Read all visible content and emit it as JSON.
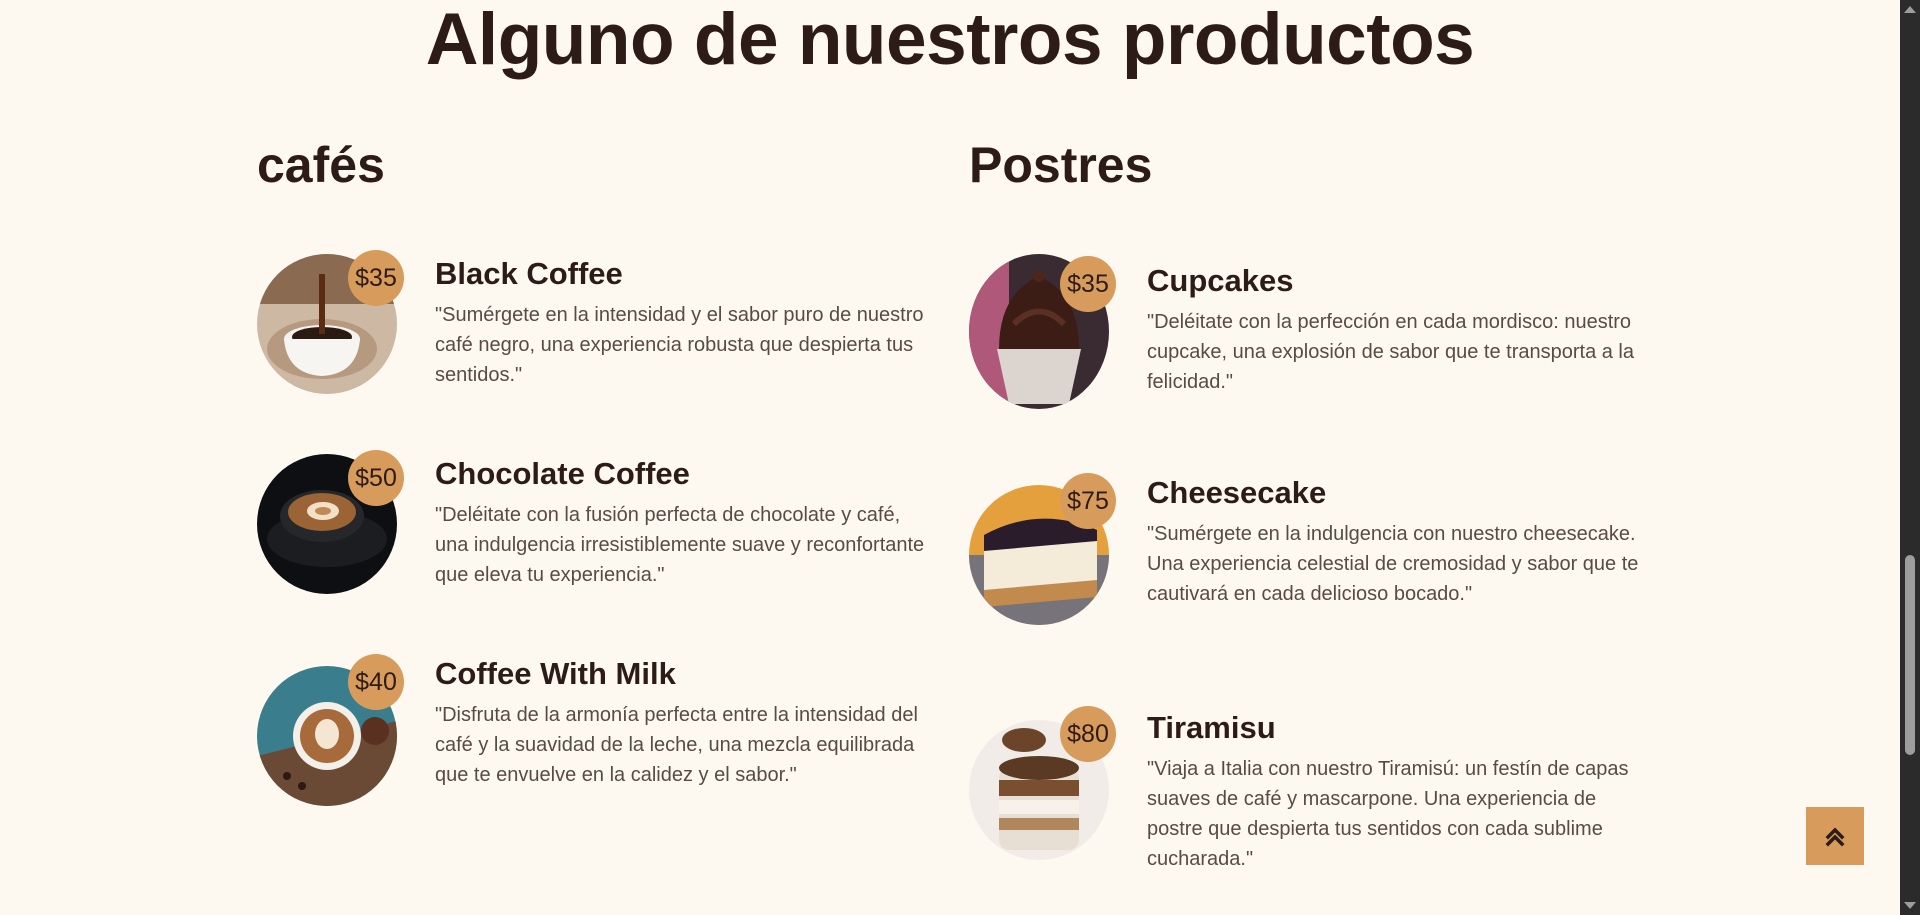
{
  "page": {
    "title": "Alguno de nuestros productos"
  },
  "cafes": {
    "title": "cafés",
    "items": [
      {
        "name": "Black Coffee",
        "price": "$35",
        "description": "\"Sumérgete en la intensidad y el sabor puro de nuestro café negro, una experiencia robusta que despierta tus sentidos.\""
      },
      {
        "name": "Chocolate Coffee",
        "price": "$50",
        "description": "\"Deléitate con la fusión perfecta de chocolate y café, una indulgencia irresistiblemente suave y reconfortante que eleva tu experiencia.\""
      },
      {
        "name": "Coffee With Milk",
        "price": "$40",
        "description": "\"Disfruta de la armonía perfecta entre la intensidad del café y la suavidad de la leche, una mezcla equilibrada que te envuelve en la calidez y el sabor.\""
      }
    ]
  },
  "postres": {
    "title": "Postres",
    "items": [
      {
        "name": "Cupcakes",
        "price": "$35",
        "description": "\"Deléitate con la perfección en cada mordisco: nuestro cupcake, una explosión de sabor que te transporta a la felicidad.\""
      },
      {
        "name": "Cheesecake",
        "price": "$75",
        "description": "\"Sumérgete en la indulgencia con nuestro cheesecake. Una experiencia celestial de cremosidad y sabor que te cautivará en cada delicioso bocado.\""
      },
      {
        "name": "Tiramisu",
        "price": "$80",
        "description": "\"Viaja a Italia con nuestro Tiramisú: un festín de capas suaves de café y mascarpone. Una experiencia de postre que despierta tus sentidos con cada sublime cucharada.\""
      }
    ]
  },
  "colors": {
    "background": "#fdf9f1",
    "accent": "#d79c5c",
    "text": "#2d1b17"
  },
  "icons": {
    "scroll_to_top": "double-chevron-up-icon"
  }
}
